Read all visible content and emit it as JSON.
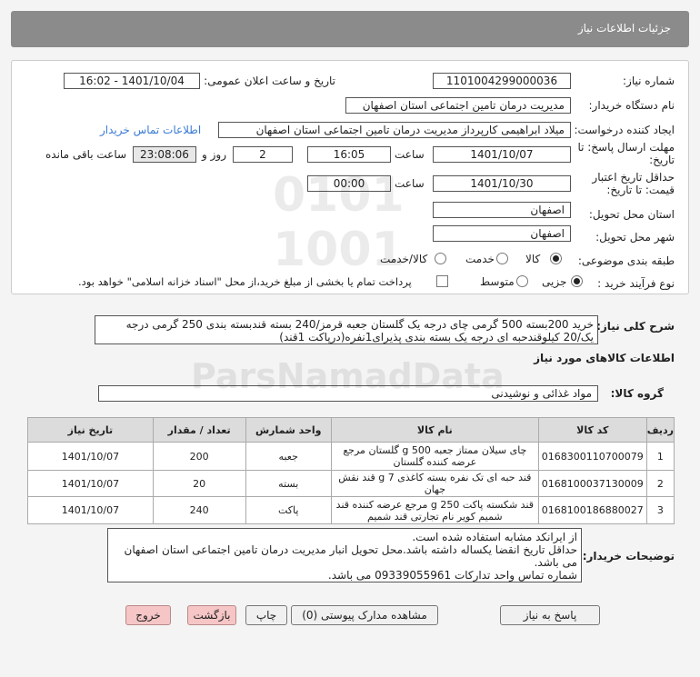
{
  "header": {
    "title": "جزئیات اطلاعات نیاز"
  },
  "form": {
    "need_number_label": "شماره نیاز:",
    "need_number": "1101004299000036",
    "announce_label": "تاریخ و ساعت اعلان عمومی:",
    "announce_value": "1401/10/04 - 16:02",
    "buyer_org_label": "نام دستگاه خریدار:",
    "buyer_org": "مدیریت درمان تامین اجتماعی استان اصفهان",
    "creator_label": "ایجاد کننده درخواست:",
    "creator": "میلاد ابراهیمی کارپرداز مدیریت درمان تامین اجتماعی استان اصفهان",
    "contact_link": "اطلاعات تماس خریدار",
    "deadline_label_1": "مهلت ارسال پاسخ: تا",
    "deadline_label_2": "تاریخ:",
    "deadline_date": "1401/10/07",
    "time_label": "ساعت",
    "deadline_time": "16:05",
    "days_value": "2",
    "days_label": "روز و",
    "remaining_time": "23:08:06",
    "remaining_label": "ساعت باقی مانده",
    "validity_label_1": "حداقل تاریخ اعتبار",
    "validity_label_2": "قیمت: تا تاریخ:",
    "validity_date": "1401/10/30",
    "validity_time_label": "ساعت",
    "validity_time": "00:00",
    "province_label": "استان محل تحویل:",
    "province": "اصفهان",
    "city_label": "شهر محل تحویل:",
    "city": "اصفهان",
    "category_label": "طبقه بندی موضوعی:",
    "category_options": [
      "کالا",
      "خدمت",
      "کالا/خدمت"
    ],
    "process_label": "نوع فرآیند خرید :",
    "process_options": [
      "جزیی",
      "متوسط"
    ],
    "payment_note": "پرداخت تمام یا بخشی از مبلغ خرید،از محل \"اسناد خزانه اسلامی\" خواهد بود."
  },
  "summary": {
    "label": "شرح کلی نیاز:",
    "line1": "خرید 200بسته 500 گرمی چای درجه یک گلستان جعبه قرمز/240 بسته قندبسته بندی 250 گرمی درجه",
    "line2": "یک/20 کیلوقندحبه ای درجه یک بسته بندی پذیرای1نفره(درپاکت 1قند)"
  },
  "goods": {
    "section_title": "اطلاعات کالاهای مورد نیاز",
    "group_label": "گروه کالا:",
    "group_value": "مواد غذائی و نوشیدنی",
    "columns": [
      "ردیف",
      "کد کالا",
      "نام کالا",
      "واحد شمارش",
      "تعداد / مقدار",
      "تاریخ نیاز"
    ],
    "rows": [
      {
        "index": "1",
        "code": "0168300110700079",
        "name": "چای سیلان ممتاز جعبه 500 g گلستان مرجع عرضه کننده گلستان",
        "unit": "جعبه",
        "qty": "200",
        "date": "1401/10/07"
      },
      {
        "index": "2",
        "code": "0168100037130009",
        "name": "قند حبه ای تک نفره بسته کاغذی 7 g قند نقش جهان",
        "unit": "بسته",
        "qty": "20",
        "date": "1401/10/07"
      },
      {
        "index": "3",
        "code": "0168100186880027",
        "name": "قند شکسته پاکت 250 g مرجع عرضه کننده قند شمیم کویر نام تجارتی قند شمیم",
        "unit": "پاکت",
        "qty": "240",
        "date": "1401/10/07"
      }
    ]
  },
  "buyer_notes": {
    "label": "توضیحات خریدار:",
    "line1": "از ایرانکد مشابه استفاده شده است.",
    "line2": "حداقل تاریخ انقضا یکساله داشته باشد.محل تحویل انبار مدیریت درمان تامین اجتماعی استان اصفهان",
    "line3": "می باشد.",
    "line4": "شماره تماس واحد تدارکات 09339055961 می باشد."
  },
  "buttons": {
    "reply": "پاسخ به نیاز",
    "attachments": "مشاهده مدارک پیوستی (0)",
    "print": "چاپ",
    "back": "بازگشت",
    "exit": "خروج"
  }
}
